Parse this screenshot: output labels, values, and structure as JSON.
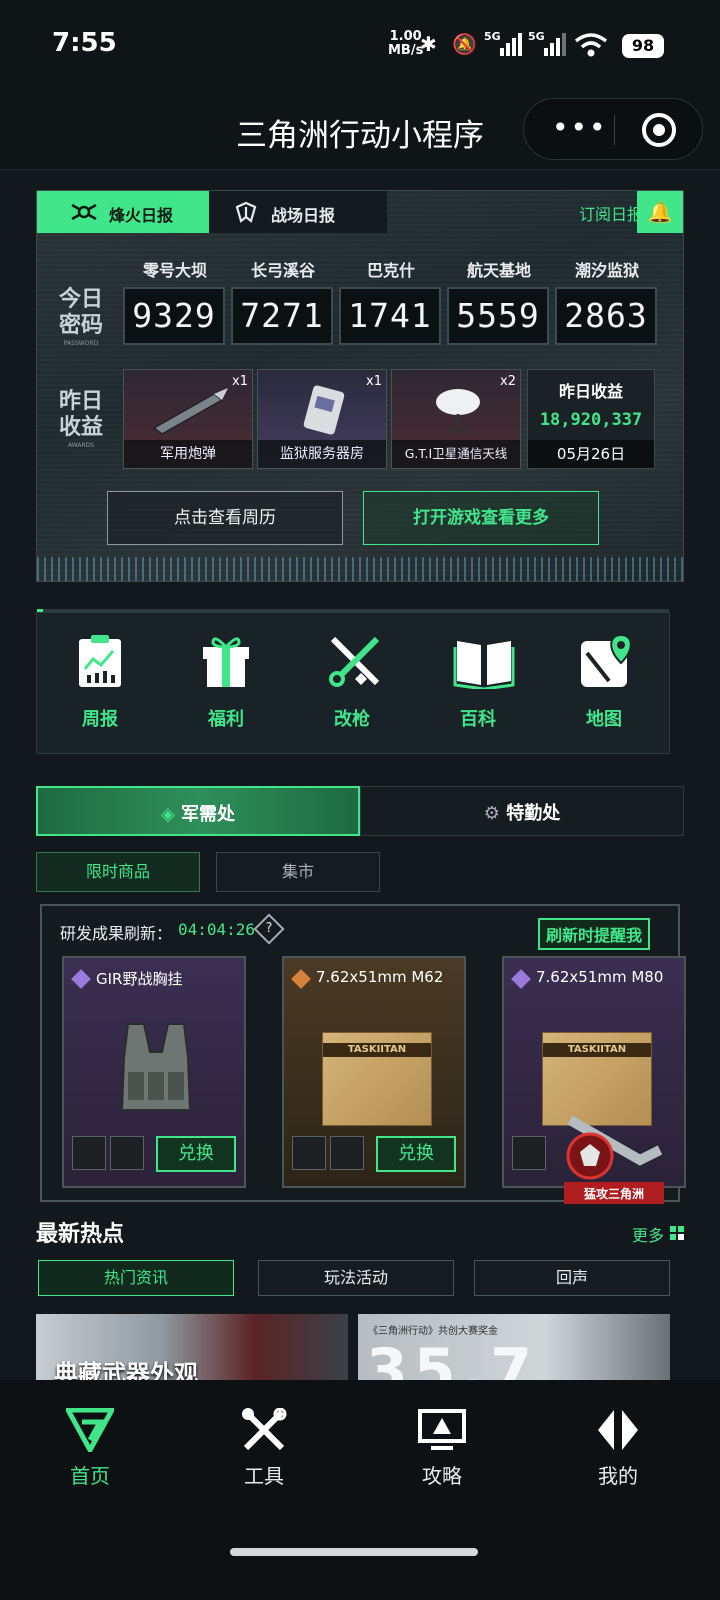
{
  "status_bar": {
    "time": "7:55",
    "net_speed_value": "1.00",
    "net_speed_unit": "MB/s",
    "signal1": "5G",
    "signal2": "5G",
    "battery": "98"
  },
  "title_bar": {
    "title": "三角洲行动小程序"
  },
  "daily": {
    "tabs": [
      "烽火日报",
      "战场日报"
    ],
    "subscribe": "订阅日报",
    "password_label": "今日密码",
    "password_sublabel": "PASSWORD",
    "maps": [
      {
        "name": "零号大坝",
        "code": "9329"
      },
      {
        "name": "长弓溪谷",
        "code": "7271"
      },
      {
        "name": "巴克什",
        "code": "1741"
      },
      {
        "name": "航天基地",
        "code": "5559"
      },
      {
        "name": "潮汐监狱",
        "code": "2863"
      }
    ],
    "awards_label": "昨日收益",
    "awards_sublabel": "AWARDS",
    "awards": [
      {
        "name": "军用炮弹",
        "count": "x1"
      },
      {
        "name": "监狱服务器房",
        "count": "x1"
      },
      {
        "name": "G.T.I卫星通信天线",
        "count": "x2"
      }
    ],
    "income_title": "昨日收益",
    "income_value": "18,920,337",
    "income_date": "05月26日",
    "btn_calendar": "点击查看周历",
    "btn_open_game": "打开游戏查看更多"
  },
  "shortcuts": [
    {
      "label": "周报",
      "icon": "report-icon"
    },
    {
      "label": "福利",
      "icon": "gift-icon"
    },
    {
      "label": "改枪",
      "icon": "gun-wrench-icon"
    },
    {
      "label": "百科",
      "icon": "book-icon"
    },
    {
      "label": "地图",
      "icon": "map-pin-icon"
    }
  ],
  "supply": {
    "tabs": [
      "军需处",
      "特勤处"
    ],
    "subtabs": [
      "限时商品",
      "集市"
    ],
    "refresh_label": "研发成果刷新：",
    "refresh_timer": "04:04:26",
    "remind_btn": "刷新时提醒我",
    "items": [
      {
        "name": "GIR野战胸挂",
        "button": "兑换"
      },
      {
        "name": "7.62x51mm M62",
        "button": "兑换"
      },
      {
        "name": "7.62x51mm M80",
        "button": ""
      }
    ],
    "box_brand": "TASKIITAN"
  },
  "promo": {
    "label": "猛攻三角洲"
  },
  "news": {
    "title": "最新热点",
    "more": "更多",
    "tabs": [
      "热门资讯",
      "玩法活动",
      "回声"
    ],
    "thumbs": [
      {
        "title": "典藏武器外观"
      },
      {
        "caption": "《三角洲行动》共创大赛奖金",
        "big": "35.7"
      }
    ]
  },
  "bottom_nav": [
    {
      "label": "首页"
    },
    {
      "label": "工具"
    },
    {
      "label": "攻略"
    },
    {
      "label": "我的"
    }
  ],
  "colors": {
    "accent": "#42e68a",
    "background": "#12181b"
  }
}
